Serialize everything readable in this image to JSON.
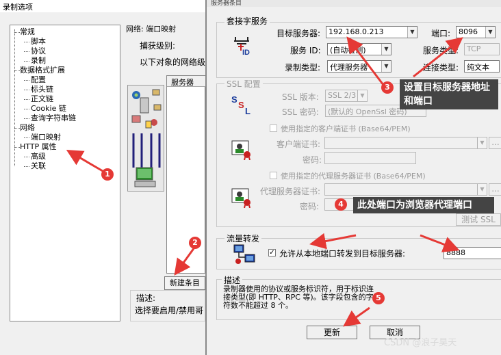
{
  "background_window": {
    "title": "录制选项",
    "tree": {
      "items": [
        {
          "label": "常规",
          "level": 1
        },
        {
          "label": "脚本",
          "level": 2
        },
        {
          "label": "协议",
          "level": 2
        },
        {
          "label": "录制",
          "level": 2
        },
        {
          "label": "数据格式扩展",
          "level": 1
        },
        {
          "label": "配置",
          "level": 2
        },
        {
          "label": "标头链",
          "level": 2
        },
        {
          "label": "正文链",
          "level": 2
        },
        {
          "label": "Cookie 链",
          "level": 2
        },
        {
          "label": "查询字符串链",
          "level": 2
        },
        {
          "label": "网络",
          "level": 1
        },
        {
          "label": "端口映射",
          "level": 2
        },
        {
          "label": "HTTP 属性",
          "level": 1
        },
        {
          "label": "高级",
          "level": 2
        },
        {
          "label": "关联",
          "level": 2
        }
      ]
    },
    "group_title": "网络: 端口映射",
    "capture_level_label": "捕获级别:",
    "network_text": "以下对象的网络级",
    "server_column": "服务器",
    "new_entry_button": "新建条目",
    "desc_label": "描述:",
    "desc_text": "选择要启用/禁用哥"
  },
  "dialog": {
    "title": "服务器条目",
    "socket_group": "套接字服务",
    "target_server_label": "目标服务器:",
    "target_server_value": "192.168.0.213",
    "port_label": "端口:",
    "port_value": "8096",
    "service_id_label": "服务 ID:",
    "service_id_value": "(自动检测)",
    "service_type_label": "服务类型:",
    "service_type_value": "TCP",
    "record_type_label": "录制类型:",
    "record_type_value": "代理服务器",
    "connect_type_label": "连接类型:",
    "connect_type_value": "纯文本",
    "ssl_group": "SSL 配置",
    "ssl_version_label": "SSL 版本:",
    "ssl_version_value": "SSL 2/3",
    "ssl_password_label": "SSL 密码:",
    "ssl_password_value": "(默认的 OpenSsl 密码)",
    "use_client_cert_label": "使用指定的客户端证书 (Base64/PEM)",
    "client_cert_label": "客户端证书:",
    "password_label": "密码:",
    "use_proxy_cert_label": "使用指定的代理服务器证书 (Base64/PEM)",
    "proxy_cert_label": "代理服务器证书:",
    "proxy_password_label": "密码:",
    "browse_label": "...",
    "test_ssl_button": "测试 SSL",
    "forwarding_group": "流量转发",
    "forward_checkbox_label": "允许从本地端口转发到目标服务器:",
    "forward_checked": true,
    "forward_port_value": "8888",
    "desc_group": "描述",
    "desc_text": "录制器使用的协议或服务标识符，用于标识连接类型(即 HTTP、RPC 等)。该字段包含的字符数不能超过 8 个。",
    "update_button": "更新",
    "cancel_button": "取消"
  },
  "annotations": {
    "badge_1": "1",
    "badge_2": "2",
    "badge_3": "3",
    "badge_4": "4",
    "badge_5": "5",
    "callout_3": "设置目标服务器地址和端口",
    "callout_4": "此处端口为浏览器代理端口",
    "color": "#e53935"
  },
  "watermark": "CSDN @浪子昊天"
}
